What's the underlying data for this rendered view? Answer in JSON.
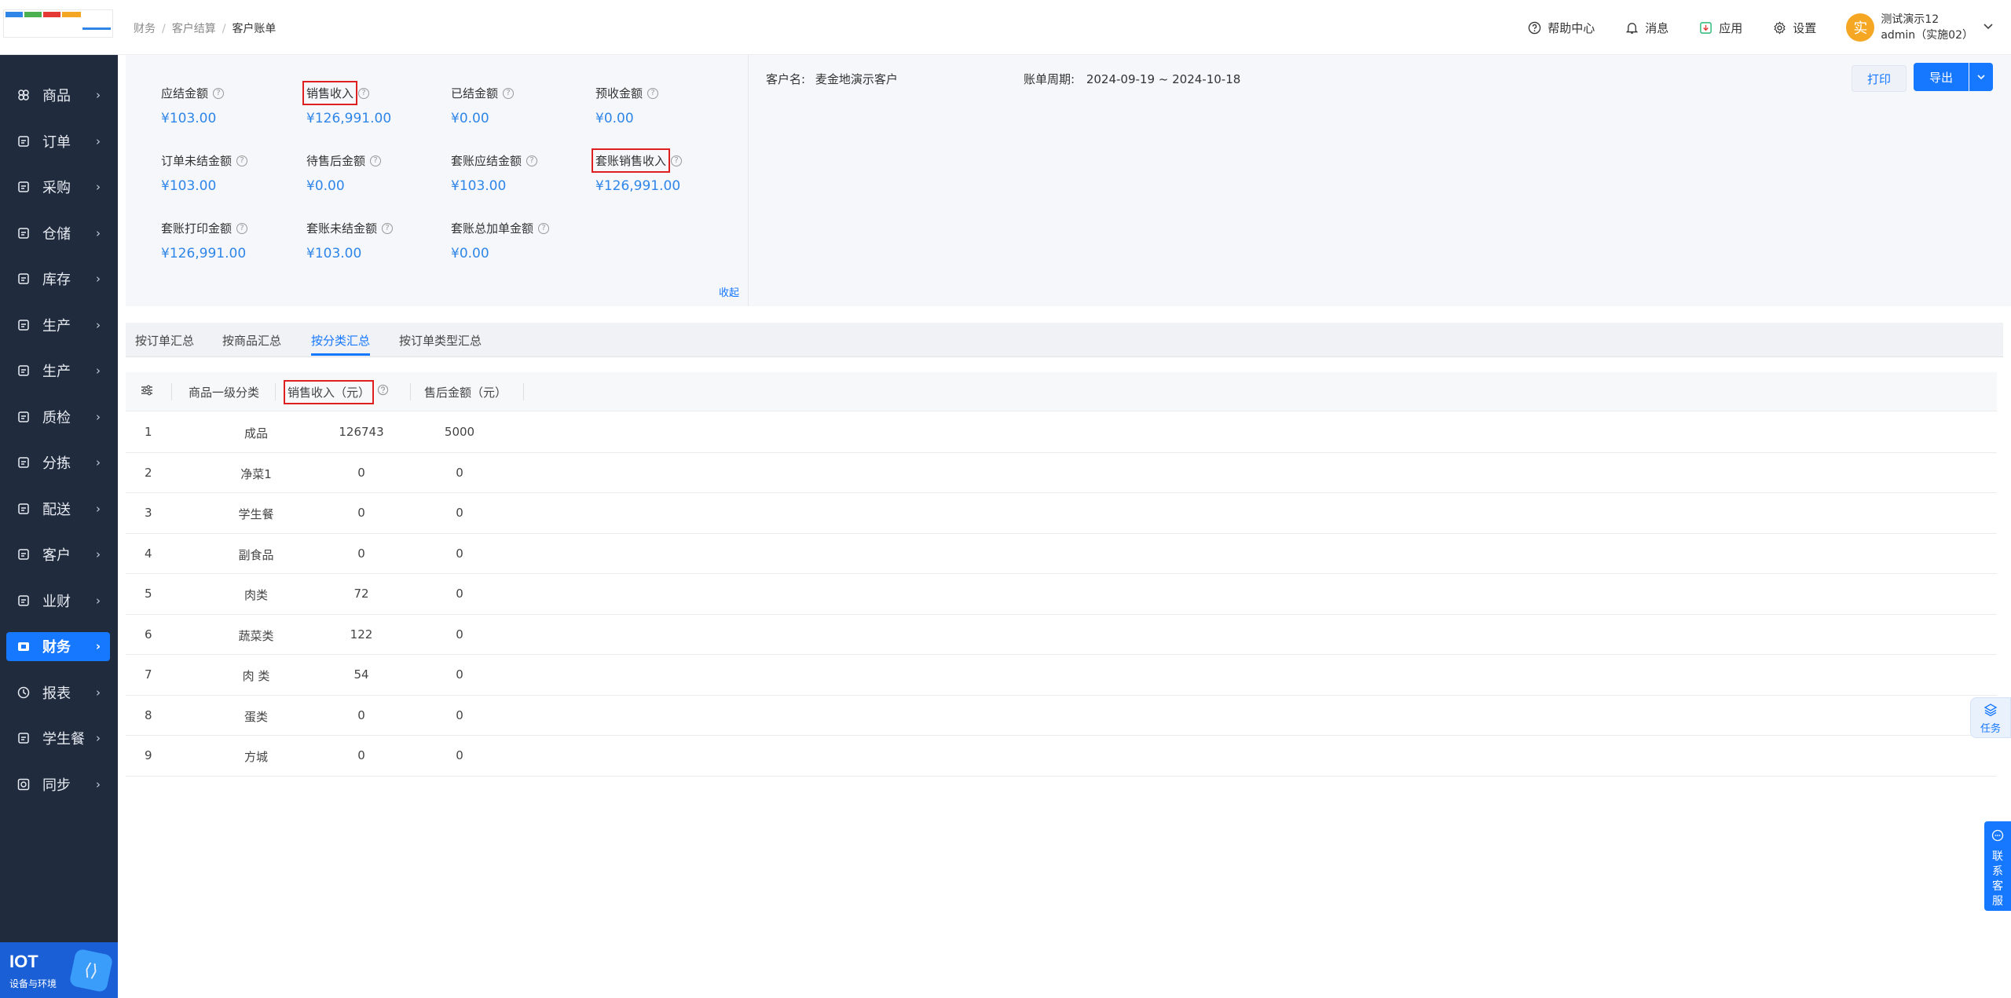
{
  "breadcrumb": [
    "财务",
    "客户结算",
    "客户账单"
  ],
  "topbar": {
    "help": "帮助中心",
    "messages": "消息",
    "apps": "应用",
    "settings": "设置",
    "avatar_char": "实",
    "user_name": "测试演示12",
    "user_account": "admin（实施02）"
  },
  "sidebar": {
    "items": [
      {
        "label": "商品",
        "icon": "goods-icon"
      },
      {
        "label": "订单",
        "icon": "order-icon"
      },
      {
        "label": "采购",
        "icon": "purchase-icon"
      },
      {
        "label": "仓储",
        "icon": "warehouse-icon"
      },
      {
        "label": "库存",
        "icon": "inventory-icon"
      },
      {
        "label": "生产",
        "icon": "production-icon"
      },
      {
        "label": "生产",
        "icon": "production-icon"
      },
      {
        "label": "质检",
        "icon": "quality-icon"
      },
      {
        "label": "分拣",
        "icon": "sorting-icon"
      },
      {
        "label": "配送",
        "icon": "delivery-icon"
      },
      {
        "label": "客户",
        "icon": "customer-icon"
      },
      {
        "label": "业财",
        "icon": "business-finance-icon"
      },
      {
        "label": "财务",
        "icon": "finance-icon",
        "active": true
      },
      {
        "label": "报表",
        "icon": "report-icon"
      },
      {
        "label": "学生餐",
        "icon": "student-meal-icon"
      },
      {
        "label": "同步",
        "icon": "sync-icon"
      }
    ],
    "iot_title": "IOT",
    "iot_subtitle": "设备与环境"
  },
  "summary": {
    "metrics": [
      {
        "label": "应结金额",
        "value": "¥103.00"
      },
      {
        "label": "销售收入",
        "value": "¥126,991.00",
        "highlight": true
      },
      {
        "label": "已结金额",
        "value": "¥0.00"
      },
      {
        "label": "预收金额",
        "value": "¥0.00"
      },
      {
        "label": "订单未结金额",
        "value": "¥103.00"
      },
      {
        "label": "待售后金额",
        "value": "¥0.00"
      },
      {
        "label": "套账应结金额",
        "value": "¥103.00"
      },
      {
        "label": "套账销售收入",
        "value": "¥126,991.00",
        "highlight": true
      },
      {
        "label": "套账打印金额",
        "value": "¥126,991.00"
      },
      {
        "label": "套账未结金额",
        "value": "¥103.00"
      },
      {
        "label": "套账总加单金额",
        "value": "¥0.00"
      }
    ],
    "collapse_label": "收起"
  },
  "info": {
    "customer_label": "客户名:",
    "customer_name": "麦金地演示客户",
    "period_label": "账单周期:",
    "period_value": "2024-09-19 ~ 2024-10-18",
    "print_label": "打印",
    "export_label": "导出"
  },
  "tabs": [
    "按订单汇总",
    "按商品汇总",
    "按分类汇总",
    "按订单类型汇总"
  ],
  "active_tab": 2,
  "table": {
    "columns": [
      "商品一级分类",
      "销售收入（元）",
      "售后金额（元）"
    ],
    "rows": [
      {
        "no": "1",
        "category": "成品",
        "sales": "126743",
        "after_sales": "5000"
      },
      {
        "no": "2",
        "category": "净菜1",
        "sales": "0",
        "after_sales": "0"
      },
      {
        "no": "3",
        "category": "学生餐",
        "sales": "0",
        "after_sales": "0"
      },
      {
        "no": "4",
        "category": "副食品",
        "sales": "0",
        "after_sales": "0"
      },
      {
        "no": "5",
        "category": "肉类",
        "sales": "72",
        "after_sales": "0"
      },
      {
        "no": "6",
        "category": "蔬菜类",
        "sales": "122",
        "after_sales": "0"
      },
      {
        "no": "7",
        "category": "肉 类",
        "sales": "54",
        "after_sales": "0"
      },
      {
        "no": "8",
        "category": "蛋类",
        "sales": "0",
        "after_sales": "0"
      },
      {
        "no": "9",
        "category": "方城",
        "sales": "0",
        "after_sales": "0"
      }
    ]
  },
  "float": {
    "task_label": "任务",
    "cs_label": "联系客服"
  },
  "colors": {
    "primary": "#1677ff",
    "sidebar_bg": "#202b3e",
    "value_blue": "#2f86e8",
    "highlight_red": "#e02020"
  }
}
